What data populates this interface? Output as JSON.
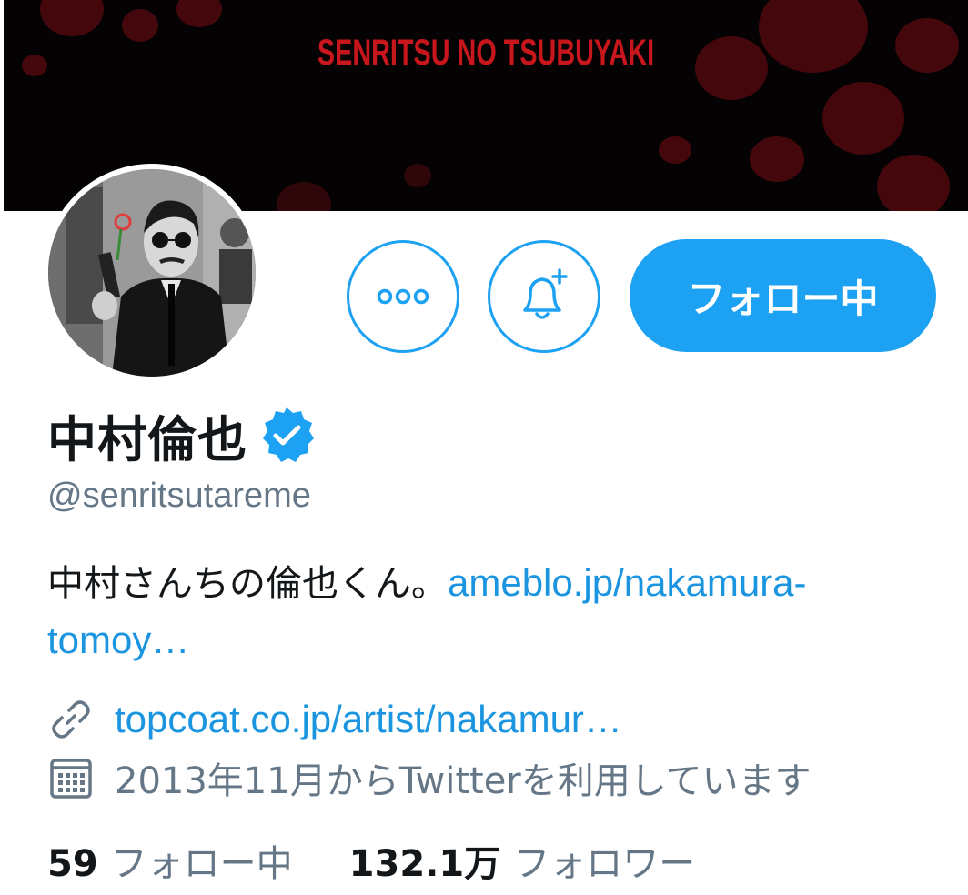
{
  "banner": {
    "title": "SENRITSU NO TSUBUYAKI"
  },
  "actions": {
    "more_icon": "more-horizontal-icon",
    "notify_icon": "bell-plus-icon",
    "follow_label": "フォロー中"
  },
  "profile": {
    "display_name": "中村倫也",
    "verified_icon": "verified-badge-icon",
    "handle": "@senritsutareme",
    "bio_text": "中村さんちの倫也くん。",
    "bio_link": "ameblo.jp/nakamura-tomoy…",
    "website": "topcoat.co.jp/artist/nakamur…",
    "joined": "2013年11月からTwitterを利用しています"
  },
  "stats": {
    "following_count": "59",
    "following_label": "フォロー中",
    "followers_count": "132.1万",
    "followers_label": "フォロワー"
  },
  "colors": {
    "accent": "#1da1f2",
    "link": "#1b95e0",
    "secondary_text": "#657786",
    "primary_text": "#14171a",
    "banner_text": "#c8161d"
  }
}
